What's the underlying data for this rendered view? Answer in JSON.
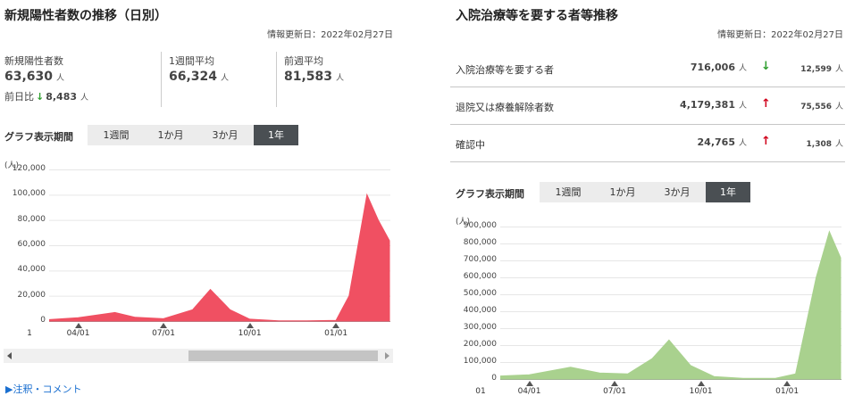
{
  "left": {
    "title": "新規陽性者数の推移（日別）",
    "updated": "情報更新日：2022年02月27日",
    "stats": {
      "new_label": "新規陽性者数",
      "new_value": "63,630",
      "diff_label": "前日比",
      "diff_value": "8,483",
      "week_avg_label": "1週間平均",
      "week_avg_value": "66,324",
      "prev_week_label": "前週平均",
      "prev_week_value": "81,583",
      "unit": "人"
    },
    "period_label": "グラフ表示期間",
    "tabs": [
      "1週間",
      "1か月",
      "3か月",
      "1年"
    ],
    "active_tab": "1年",
    "note_link": "▶注釈・コメント"
  },
  "right": {
    "title": "入院治療等を要する者等推移",
    "updated": "情報更新日：2022年02月27日",
    "unit": "人",
    "rows": [
      {
        "label": "入院治療等を要する者",
        "value": "716,006",
        "arrow": "↓",
        "arrow_color": "#2e9e2e",
        "diff": "12,599"
      },
      {
        "label": "退院又は療養解除者数",
        "value": "4,179,381",
        "arrow": "↑",
        "arrow_color": "#d0021b",
        "diff": "75,556"
      },
      {
        "label": "確認中",
        "value": "24,765",
        "arrow": "↑",
        "arrow_color": "#d0021b",
        "diff": "1,308"
      }
    ],
    "period_label": "グラフ表示期間",
    "tabs": [
      "1週間",
      "1か月",
      "3か月",
      "1年"
    ],
    "active_tab": "1年"
  },
  "chart_data": [
    {
      "type": "area",
      "color": "#f05062",
      "unit_label": "(人)",
      "ylim": [
        0,
        120000
      ],
      "yticks": [
        "120,000",
        "100,000",
        "80,000",
        "60,000",
        "40,000",
        "20,000",
        "0"
      ],
      "x_labels": [
        "1",
        "04/01",
        "07/01",
        "10/01",
        "01/01"
      ],
      "series": [
        {
          "x": [
            "2021-03-01",
            "2021-04-01",
            "2021-05-10",
            "2021-06-01",
            "2021-07-01",
            "2021-08-01",
            "2021-08-20",
            "2021-09-10",
            "2021-10-01",
            "2021-11-01",
            "2021-12-01",
            "2022-01-01",
            "2022-01-15",
            "2022-02-03",
            "2022-02-15",
            "2022-02-27"
          ],
          "values": [
            1100,
            2600,
            6800,
            3000,
            1800,
            9000,
            25000,
            9000,
            1500,
            200,
            200,
            500,
            20000,
            100000,
            80000,
            63630
          ]
        }
      ]
    },
    {
      "type": "area",
      "color": "#a9d18e",
      "unit_label": "(人)",
      "ylim": [
        0,
        900000
      ],
      "yticks": [
        "900,000",
        "800,000",
        "700,000",
        "600,000",
        "500,000",
        "400,000",
        "300,000",
        "200,000",
        "100,000",
        "0"
      ],
      "x_labels": [
        "01",
        "04/01",
        "07/01",
        "10/01",
        "01/01"
      ],
      "series": [
        {
          "x": [
            "2021-03-01",
            "2021-04-01",
            "2021-05-15",
            "2021-06-15",
            "2021-07-15",
            "2021-08-10",
            "2021-08-28",
            "2021-09-20",
            "2021-10-15",
            "2021-11-15",
            "2021-12-20",
            "2022-01-10",
            "2022-02-01",
            "2022-02-15",
            "2022-02-27"
          ],
          "values": [
            18000,
            25000,
            70000,
            35000,
            30000,
            120000,
            230000,
            80000,
            15000,
            4000,
            5000,
            30000,
            600000,
            870000,
            716006
          ]
        }
      ]
    }
  ]
}
